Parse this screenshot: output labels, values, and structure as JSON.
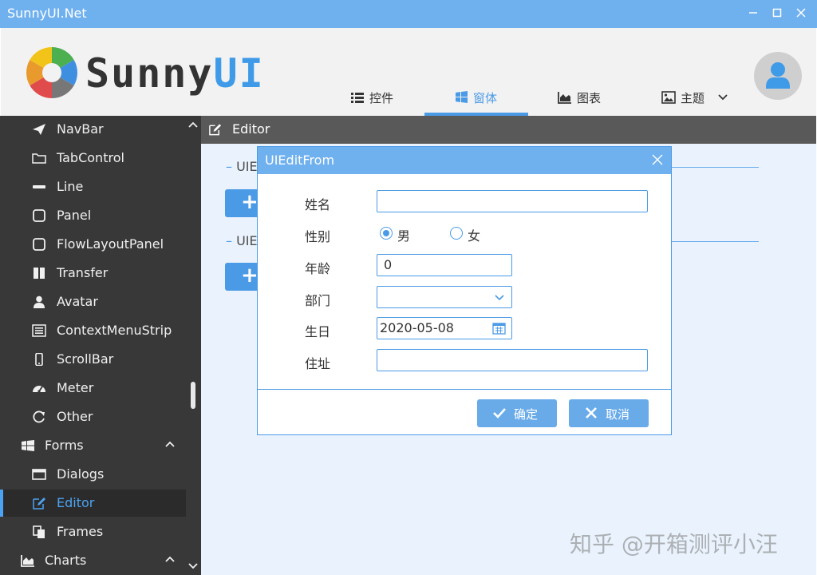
{
  "window": {
    "title": "SunnyUI.Net"
  },
  "brand": {
    "logo_sunny": "Sunny",
    "logo_ui": "UI",
    "accent": "#4a9ae6",
    "sidebar_bg": "#383838"
  },
  "nav": {
    "tabs": [
      {
        "label": "控件",
        "icon": "list-icon"
      },
      {
        "label": "窗体",
        "icon": "windows-icon",
        "active": true
      },
      {
        "label": "图表",
        "icon": "area-chart-icon"
      },
      {
        "label": "主题",
        "icon": "image-icon"
      }
    ]
  },
  "sidebar": {
    "items": [
      {
        "label": "NavBar",
        "icon": "paper-plane-icon"
      },
      {
        "label": "TabControl",
        "icon": "folder-icon"
      },
      {
        "label": "Line",
        "icon": "minus-icon"
      },
      {
        "label": "Panel",
        "icon": "square-icon"
      },
      {
        "label": "FlowLayoutPanel",
        "icon": "square-icon"
      },
      {
        "label": "Transfer",
        "icon": "columns-icon"
      },
      {
        "label": "Avatar",
        "icon": "user-icon"
      },
      {
        "label": "ContextMenuStrip",
        "icon": "menu-icon"
      },
      {
        "label": "ScrollBar",
        "icon": "mobile-icon"
      },
      {
        "label": "Meter",
        "icon": "dashboard-icon"
      },
      {
        "label": "Other",
        "icon": "refresh-icon"
      },
      {
        "label": "Forms",
        "icon": "windows-icon",
        "group": true,
        "expanded": true
      },
      {
        "label": "Dialogs",
        "icon": "window-icon"
      },
      {
        "label": "Editor",
        "icon": "edit-icon",
        "selected": true
      },
      {
        "label": "Frames",
        "icon": "copy-icon"
      },
      {
        "label": "Charts",
        "icon": "area-chart-icon",
        "group": true,
        "expanded": true
      }
    ]
  },
  "page": {
    "title": "Editor",
    "group1_title": "UIE",
    "group2_title": "UIE",
    "add_label": "+"
  },
  "dialog": {
    "title": "UIEditFrom",
    "fields": {
      "name_label": "姓名",
      "name_value": "",
      "gender_label": "性别",
      "gender_male": "男",
      "gender_female": "女",
      "gender_selected": "男",
      "age_label": "年龄",
      "age_value": "0",
      "dept_label": "部门",
      "dept_value": "",
      "birthday_label": "生日",
      "birthday_value": "2020-05-08",
      "address_label": "住址",
      "address_value": ""
    },
    "ok_label": "确定",
    "cancel_label": "取消"
  },
  "watermark": "知乎 @开箱测评小汪"
}
